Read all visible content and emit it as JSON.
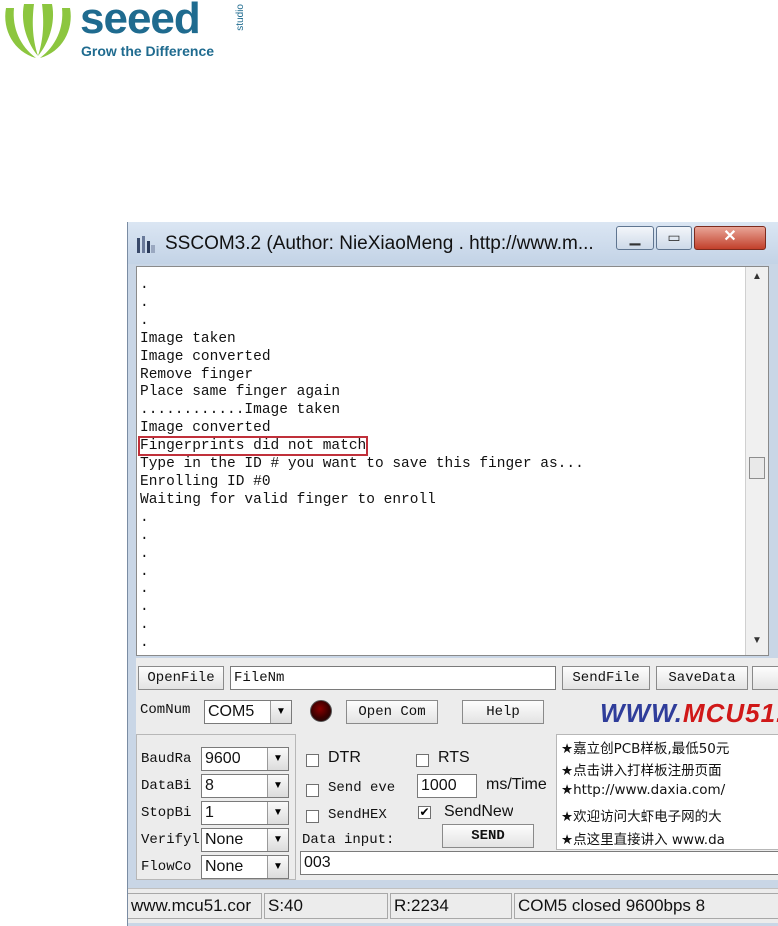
{
  "logo": {
    "word": "seeed",
    "studio": "studio",
    "tagline": "Grow the Difference"
  },
  "window": {
    "title": "SSCOM3.2 (Author: NieXiaoMeng . http://www.m...",
    "min_icon": "minimize-icon",
    "max_icon": "maximize-icon",
    "close_icon": "close-icon"
  },
  "output": {
    "lines": [
      ".",
      ".",
      ".",
      "Image taken",
      "Image converted",
      "Remove finger",
      "Place same finger again",
      "............Image taken",
      "Image converted",
      "Fingerprints did not match",
      "Type in the ID # you want to save this finger as...",
      "Enrolling ID #0",
      "Waiting for valid finger to enroll",
      ".",
      ".",
      ".",
      ".",
      ".",
      ".",
      ".",
      "."
    ],
    "highlight_color": "#c0303a"
  },
  "toolbar": {
    "openfile_label": "OpenFile",
    "filename_value": "FileNm",
    "sendfile_label": "SendFile",
    "savedata_label": "SaveData",
    "comnum_label": "ComNum",
    "comnum_value": "COM5",
    "opencom_label": "Open Com",
    "help_label": "Help",
    "banner_www": "WWW.",
    "banner_mcu": "MCU51."
  },
  "settings": {
    "baud_label": "BaudRa",
    "baud_value": "9600",
    "databits_label": "DataBi",
    "databits_value": "8",
    "stopbits_label": "StopBi",
    "stopbits_value": "1",
    "verify_label": "Verifyl",
    "verify_value": "None",
    "flow_label": "FlowCo",
    "flow_value": "None"
  },
  "options": {
    "dtr_label": "DTR",
    "rts_label": "RTS",
    "sendevery_label": "Send eve",
    "interval_value": "1000",
    "ms_label": "ms/Time",
    "sendhex_label": "SendHEX",
    "sendnew_label": "SendNew",
    "sendnew_checked": "✔",
    "datainput_label": "Data input:",
    "send_label": "SEND",
    "input_value": "003"
  },
  "ads": [
    "★嘉立创PCB样板,最低50元",
    "★点击讲入打样板注册页面",
    "★http://www.daxia.com/",
    "★欢迎访问大虾电子网的大",
    "★点这里直接讲入 www.da"
  ],
  "status": {
    "url": "www.mcu51.cor",
    "sent": "S:40",
    "received": "R:2234",
    "port_state": "COM5 closed  9600bps  8"
  }
}
